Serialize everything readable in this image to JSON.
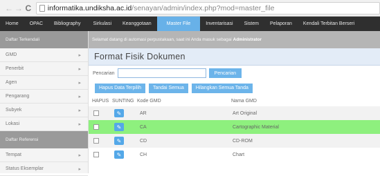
{
  "browser": {
    "url_host": "informatika.undiksha.ac.id",
    "url_path": "/senayan/admin/index.php?mod=master_file"
  },
  "menu": [
    {
      "label": "Home",
      "active": false
    },
    {
      "label": "OPAC",
      "active": false
    },
    {
      "label": "Bibliography",
      "active": false
    },
    {
      "label": "Sirkulasi",
      "active": false
    },
    {
      "label": "Keanggotaan",
      "active": false
    },
    {
      "label": "Master File",
      "active": true
    },
    {
      "label": "Inventarisasi",
      "active": false
    },
    {
      "label": "Sistem",
      "active": false
    },
    {
      "label": "Pelaporan",
      "active": false
    },
    {
      "label": "Kendali Terbitan Berseri",
      "active": false
    }
  ],
  "sidebar": {
    "terkendali_header": "Daftar Terkendali",
    "terkendali_items": [
      "GMD",
      "Penerbit",
      "Agen",
      "Pengarang",
      "Subyek",
      "Lokasi"
    ],
    "referensi_header": "Daftar Referensi",
    "referensi_items": [
      "Tempat",
      "Status Eksemplar"
    ]
  },
  "welcome": {
    "text": "Selamat datang di automasi perpustakaan, saat ini Anda masuk sebagai",
    "user": "Administrator"
  },
  "page_title": "Format Fisik Dokumen",
  "search": {
    "label": "Pencarian",
    "value": "",
    "button": "Pencarian"
  },
  "actions": {
    "delete_selected": "Hapus Data Terpilih",
    "mark_all": "Tandai Semua",
    "clear_marks": "Hilangkan Semua Tanda"
  },
  "table": {
    "headers": {
      "hapus": "HAPUS",
      "sunting": "SUNTING",
      "kode": "Kode GMD",
      "nama": "Nama GMD"
    },
    "rows": [
      {
        "kode": "AR",
        "nama": "Art Original"
      },
      {
        "kode": "CA",
        "nama": "Cartographic Material"
      },
      {
        "kode": "CD",
        "nama": "CD-ROM"
      },
      {
        "kode": "CH",
        "nama": "Chart"
      }
    ],
    "highlighted_row": 1
  },
  "colors": {
    "menu_bg": "#2f2f2f",
    "active_menu": "#68b1e8",
    "button": "#6cb4ea",
    "highlight_row": "#8ef07e"
  }
}
